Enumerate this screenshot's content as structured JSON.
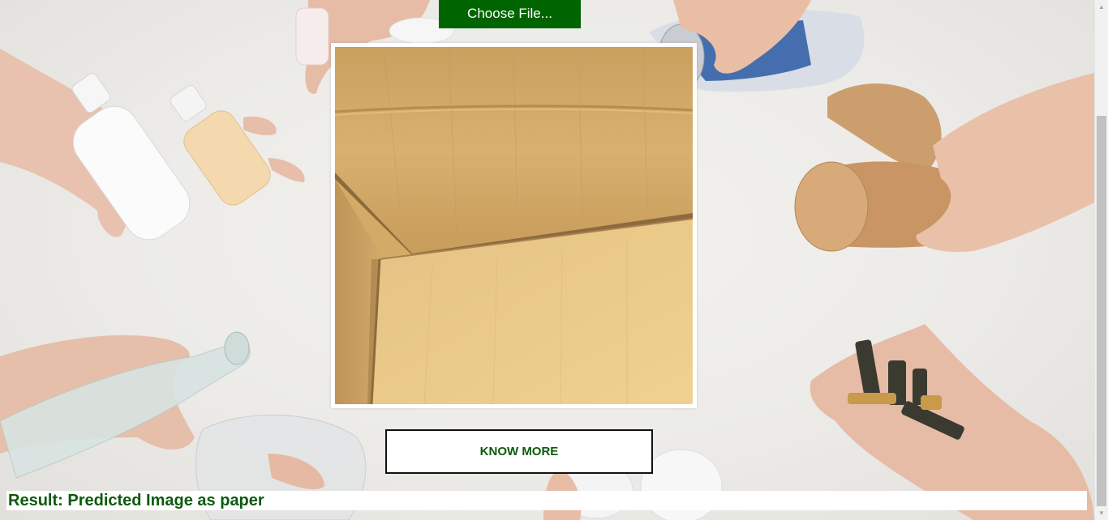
{
  "upload": {
    "choose_file_label": "Choose File..."
  },
  "preview": {
    "image_icon": "cardboard-box-photo"
  },
  "actions": {
    "know_more_label": "KNOW MORE"
  },
  "result": {
    "prefix": "Result:",
    "text": "Predicted Image as paper"
  },
  "colors": {
    "button_green": "#006400",
    "text_green": "#0c5a0c",
    "background": "#ebeae7"
  }
}
